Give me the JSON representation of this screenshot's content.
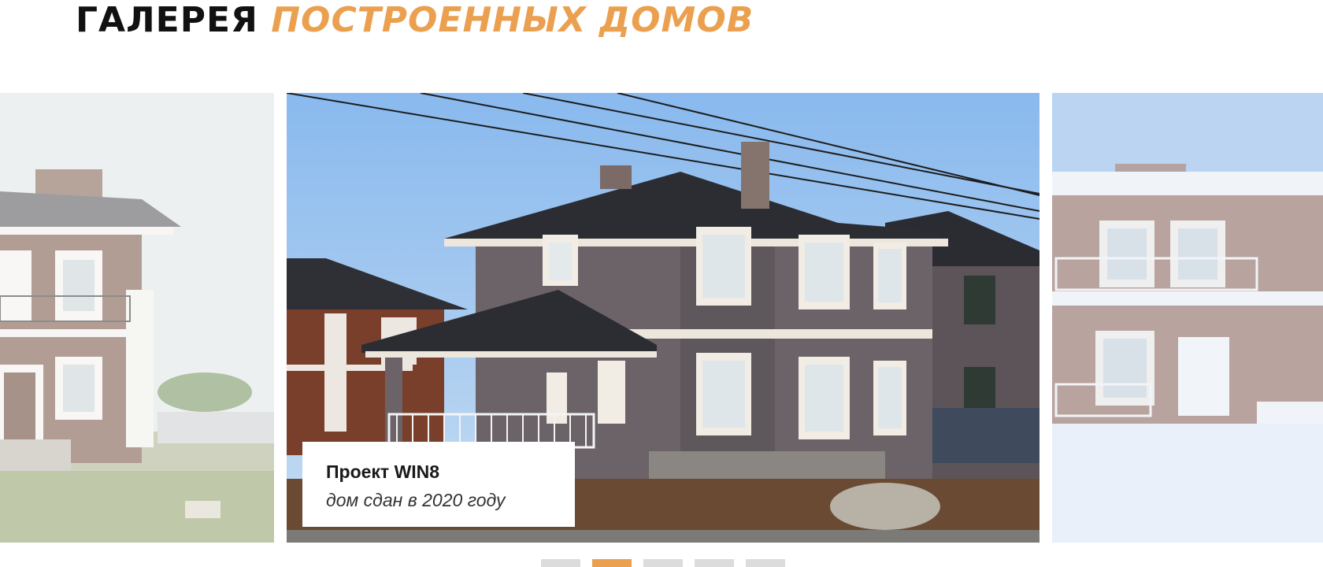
{
  "gallery": {
    "title_part1": "ГАЛЕРЕЯ",
    "title_part2": "ПОСТРОЕННЫХ ДОМОВ",
    "accent_color": "#eba050"
  },
  "carousel": {
    "active_slide": {
      "project_name": "Проект WIN8",
      "project_note": "дом сдан в 2020 году"
    },
    "pagination": {
      "count": 5,
      "active_index": 1
    },
    "inactive_color": "#dcdcdc"
  }
}
